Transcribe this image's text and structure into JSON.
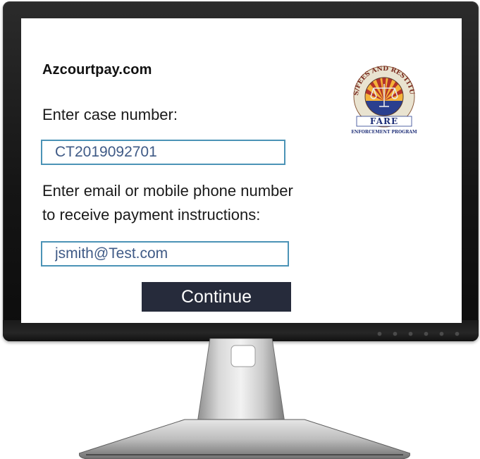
{
  "site": {
    "title": "Azcourtpay.com"
  },
  "form": {
    "case_label": "Enter case number:",
    "case_value": "CT2019092701",
    "contact_label_line1": "Enter email or mobile phone number",
    "contact_label_line2": "to receive payment instructions:",
    "contact_value": "jsmith@Test.com",
    "continue_label": "Continue"
  },
  "logo": {
    "ring_text": "FINES/FEES AND RESTITUTION",
    "name": "FARE",
    "subtitle": "ENFORCEMENT PROGRAM",
    "colors": {
      "ring": "#e9e3d0",
      "ring_text": "#7a2a1e",
      "sun": "#f4b33a",
      "rays": "#b5322a",
      "blue": "#2a3f8f",
      "scales": "#e0e0e0"
    }
  },
  "monitor": {
    "bezel_color": "#1b1b1b",
    "button_accent": "#262b3b",
    "field_border": "#4b93b6",
    "field_text": "#3f5a86"
  }
}
